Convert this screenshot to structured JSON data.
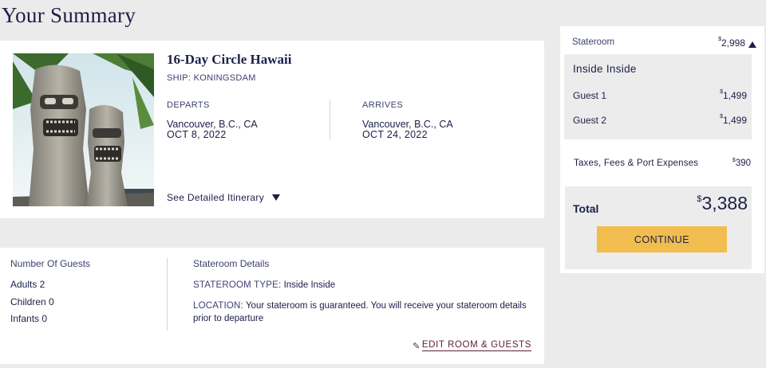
{
  "page": {
    "title": "Your Summary"
  },
  "cruise": {
    "title": "16-Day Circle Hawaii",
    "ship_label": "SHIP:",
    "ship_name": "KONINGSDAM",
    "departs": {
      "label": "DEPARTS",
      "port": "Vancouver, B.C., CA",
      "date": "OCT 8, 2022"
    },
    "arrives": {
      "label": "ARRIVES",
      "port": "Vancouver, B.C., CA",
      "date": "OCT 24, 2022"
    },
    "itinerary_link": "See Detailed Itinerary",
    "itinerary_icon": "chevron-down-icon"
  },
  "guests": {
    "label": "Number Of Guests",
    "adults": "Adults 2",
    "children": "Children 0",
    "infants": "Infants 0"
  },
  "stateroom": {
    "label": "Stateroom Details",
    "type_key": "STATEROOM TYPE:",
    "type_value": "Inside Inside",
    "location_key": "LOCATION:",
    "location_value": "Your stateroom is guaranteed. You will receive your stateroom details prior to departure",
    "edit_link": "EDIT ROOM & GUESTS",
    "edit_icon": "pencil-icon"
  },
  "summary": {
    "stateroom_label": "Stateroom",
    "currency": "$",
    "stateroom_price": "2,998",
    "collapse_icon": "chevron-up-icon",
    "room_name": "Inside Inside",
    "guests": [
      {
        "label": "Guest 1",
        "price": "1,499"
      },
      {
        "label": "Guest 2",
        "price": "1,499"
      }
    ],
    "taxes_label": "Taxes, Fees & Port Expenses",
    "taxes_price": "390",
    "total_label": "Total",
    "total_amount": "3,388",
    "continue_label": "CONTINUE"
  },
  "colors": {
    "navy": "#1b1f48",
    "gold": "#f2bd4f",
    "maroon": "#5b1e3a",
    "background": "#ebebeb"
  }
}
